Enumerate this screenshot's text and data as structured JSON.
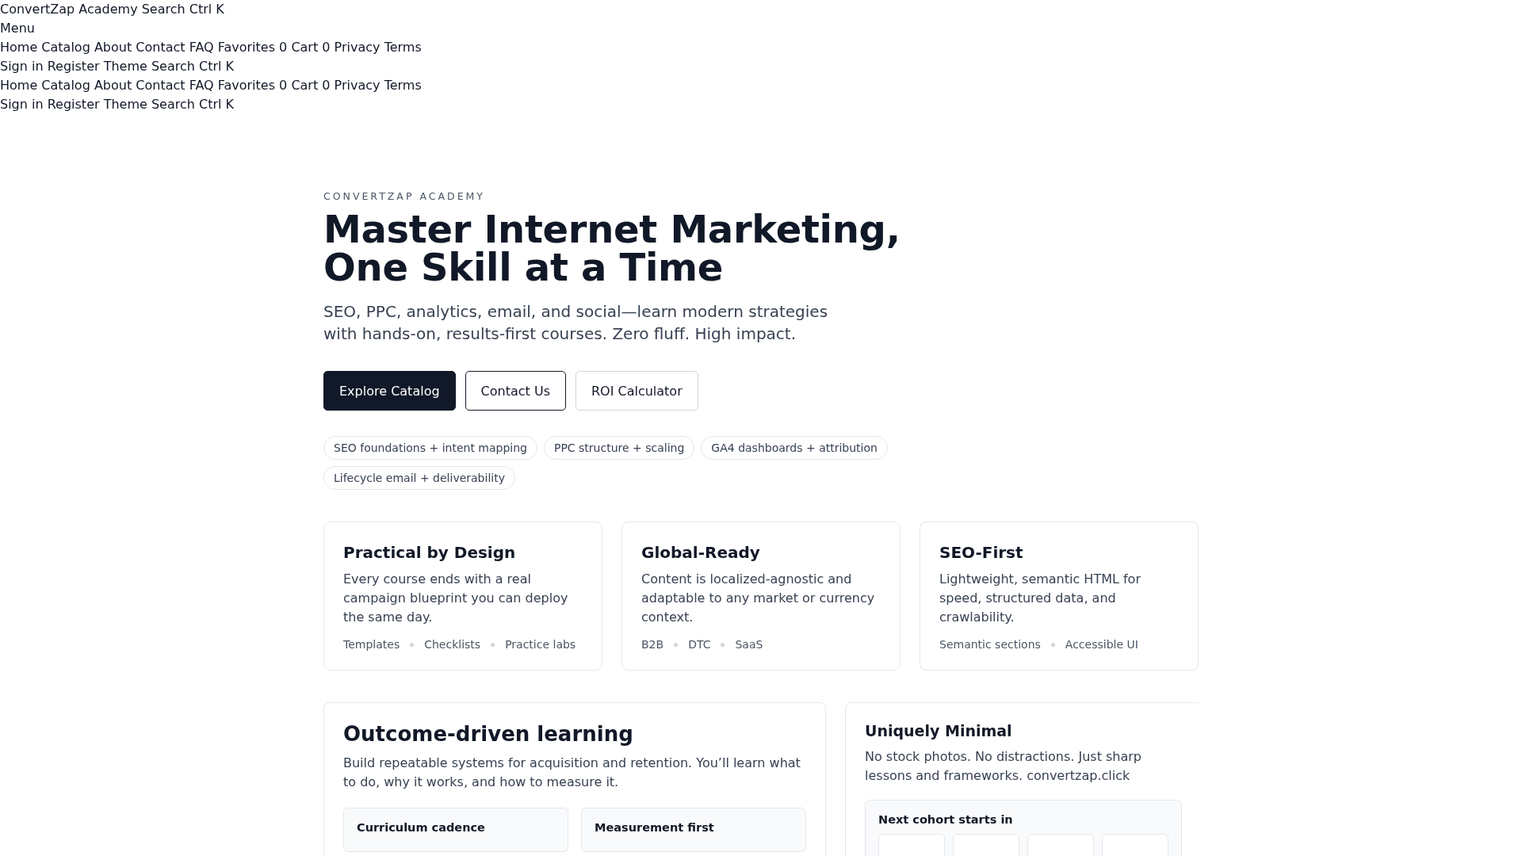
{
  "skip_links": [
    {
      "items": [
        "ConvertZap Academy",
        "Search",
        "Ctrl K"
      ]
    },
    {
      "items": [
        "Menu"
      ]
    },
    {
      "items": [
        "Home",
        "Catalog",
        "About",
        "Contact",
        "FAQ",
        "Favorites",
        "0",
        "Cart",
        "0",
        "Privacy",
        "Terms"
      ]
    },
    {
      "items": [
        "Sign in",
        "Register",
        "Theme",
        "Search",
        "Ctrl K"
      ]
    },
    {
      "items": [
        "Home",
        "Catalog",
        "About",
        "Contact",
        "FAQ",
        "Favorites",
        "0",
        "Cart",
        "0",
        "Privacy",
        "Terms"
      ]
    },
    {
      "items": [
        "Sign in",
        "Register",
        "Theme",
        "Search",
        "Ctrl K"
      ]
    }
  ],
  "hero": {
    "eyebrow": "CONVERTZAP ACADEMY",
    "title_lines": [
      "Master Internet Marketing,",
      "One Skill at a Time"
    ],
    "subtitle": "SEO, PPC, analytics, email, and social—learn modern strategies with hands-on, results-first courses. Zero fluff. High impact.",
    "buttons": [
      {
        "label": "Explore Catalog",
        "kind": "primary"
      },
      {
        "label": "Contact Us",
        "kind": "outline"
      },
      {
        "label": "ROI Calculator",
        "kind": "ghost"
      }
    ],
    "chips": [
      "SEO foundations + intent mapping",
      "PPC structure + scaling",
      "GA4 dashboards + attribution",
      "Lifecycle email + deliverability"
    ]
  },
  "features": [
    {
      "title": "Practical by Design",
      "text": "Every course ends with a real campaign blueprint you can deploy the same day.",
      "tags": [
        "Templates",
        "Checklists",
        "Practice labs"
      ]
    },
    {
      "title": "Global-Ready",
      "text": "Content is localized-agnostic and adaptable to any market or currency context.",
      "tags": [
        "B2B",
        "DTC",
        "SaaS"
      ]
    },
    {
      "title": "SEO-First",
      "text": "Lightweight, semantic HTML for speed, structured data, and crawlability.",
      "tags": [
        "Semantic sections",
        "Accessible UI"
      ]
    }
  ],
  "outcome": {
    "title": "Outcome-driven learning",
    "text": "Build repeatable systems for acquisition and retention. You’ll learn what to do, why it works, and how to measure it.",
    "panels": [
      {
        "title": "Curriculum cadence"
      },
      {
        "title": "Measurement first"
      }
    ]
  },
  "minimal": {
    "title": "Uniquely Minimal",
    "text": "No stock photos. No distractions. Just sharp lessons and frameworks. convertzap.click",
    "cohort": {
      "title": "Next cohort starts in"
    }
  }
}
